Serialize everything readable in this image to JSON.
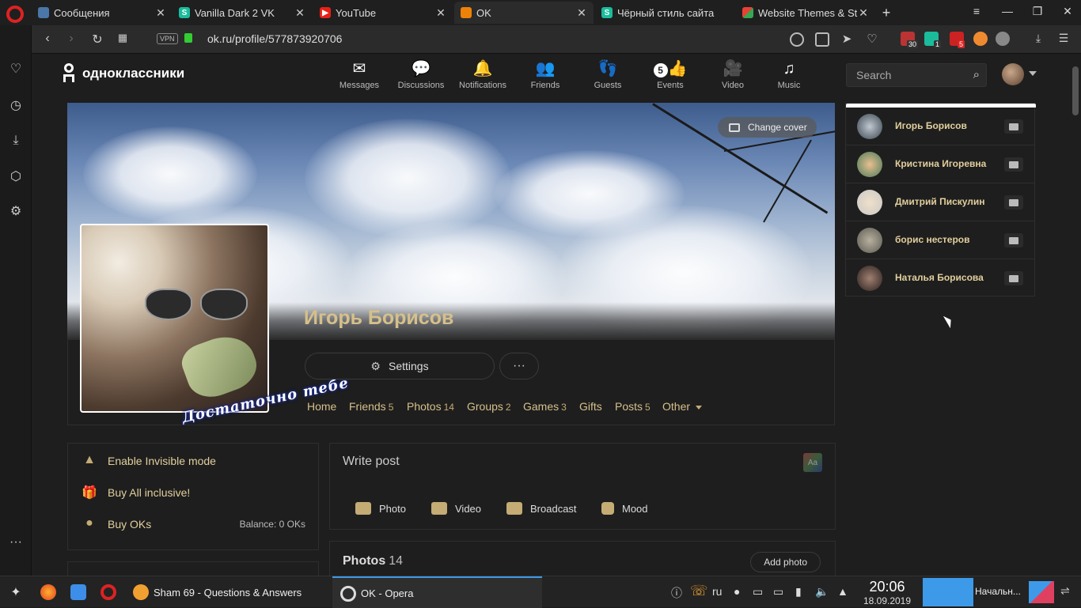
{
  "browser": {
    "tabs": [
      {
        "title": "Сообщения",
        "icon_color": "#4a76a8"
      },
      {
        "title": "Vanilla Dark 2 VK",
        "icon_color": "#1abc9c"
      },
      {
        "title": "YouTube",
        "icon_color": "#e62117"
      },
      {
        "title": "OK",
        "icon_color": "#ee8208",
        "active": true
      },
      {
        "title": "Чёрный стиль сайта",
        "icon_color": "#1abc9c"
      },
      {
        "title": "Website Themes & St",
        "icon_color": "#e94235"
      }
    ],
    "new_tab": "+",
    "url": "ok.ru/profile/577873920706",
    "vpn_label": "VPN",
    "ext_badges": {
      "ext1": "30",
      "ext2": "1",
      "ext3": "5"
    }
  },
  "ok": {
    "logo_text": "одноклассники",
    "nav": [
      {
        "label": "Messages",
        "icon": "envelope-icon"
      },
      {
        "label": "Discussions",
        "icon": "chat-icon"
      },
      {
        "label": "Notifications",
        "icon": "bell-icon"
      },
      {
        "label": "Friends",
        "icon": "people-icon"
      },
      {
        "label": "Guests",
        "icon": "footprints-icon"
      },
      {
        "label": "Events",
        "icon": "events-icon",
        "badge": "5"
      },
      {
        "label": "Video",
        "icon": "camera-icon"
      },
      {
        "label": "Music",
        "icon": "note-icon"
      }
    ],
    "search_placeholder": "Search",
    "change_cover": "Change cover",
    "profile_name": "Игорь Борисов",
    "sticker_text": "Достаточно тебе",
    "settings_label": "Settings",
    "more_label": "···",
    "subnav": [
      {
        "label": "Home",
        "count": ""
      },
      {
        "label": "Friends",
        "count": "5"
      },
      {
        "label": "Photos",
        "count": "14"
      },
      {
        "label": "Groups",
        "count": "2"
      },
      {
        "label": "Games",
        "count": "3"
      },
      {
        "label": "Gifts",
        "count": ""
      },
      {
        "label": "Posts",
        "count": "5"
      },
      {
        "label": "Other",
        "count": ""
      }
    ],
    "left_actions": [
      {
        "label": "Enable Invisible mode",
        "icon": "hat-icon"
      },
      {
        "label": "Buy All inclusive!",
        "icon": "gift-icon"
      },
      {
        "label": "Buy OKs",
        "icon": "coin-icon"
      }
    ],
    "balance": "Balance: 0 OKs",
    "write_post": "Write post",
    "font_toggle": "Aa",
    "post_actions": [
      {
        "label": "Photo",
        "icon": "camera-icon"
      },
      {
        "label": "Video",
        "icon": "video-icon"
      },
      {
        "label": "Broadcast",
        "icon": "broadcast-icon"
      },
      {
        "label": "Mood",
        "icon": "smile-icon"
      }
    ],
    "photos_title": "Photos",
    "photos_count": "14",
    "add_photo": "Add photo",
    "friends_online": [
      {
        "name": "Игорь Борисов",
        "color": "#7a8a9a"
      },
      {
        "name": "Кристина Игоревна",
        "color": "#c9a070"
      },
      {
        "name": "Дмитрий Пискулин",
        "color": "#d0d0d0"
      },
      {
        "name": "борис нестеров",
        "color": "#8a8a7a"
      },
      {
        "name": "Наталья Борисова",
        "color": "#4a3a30"
      }
    ]
  },
  "taskbar": {
    "tasks": [
      {
        "title": "Sham 69 - Questions & Answers",
        "icon_color": "#f0a030"
      },
      {
        "title": "OK - Opera",
        "icon_color": "#dddddd",
        "active": true
      }
    ],
    "lang": "ru",
    "time": "20:06",
    "date": "18.09.2019",
    "tray_app": "Начальн..."
  }
}
